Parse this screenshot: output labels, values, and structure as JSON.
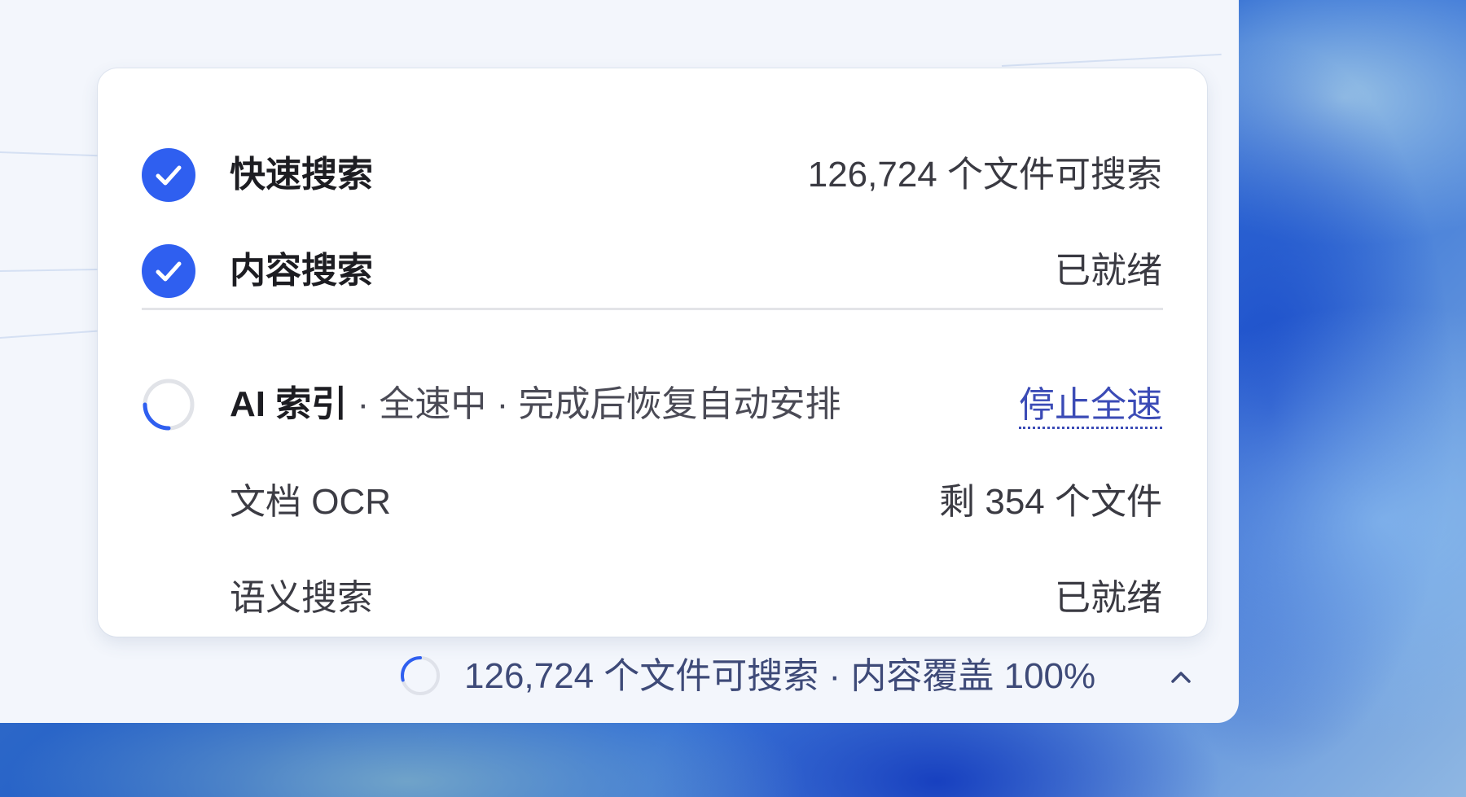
{
  "panel": {
    "rows": {
      "quick_search": {
        "label": "快速搜索",
        "status": "126,724 个文件可搜索",
        "icon": "check-circle-icon"
      },
      "content_search": {
        "label": "内容搜索",
        "status": "已就绪",
        "icon": "check-circle-icon"
      },
      "ai_index": {
        "label": "AI 索引",
        "separator": " · ",
        "detail": "全速中 · 完成后恢复自动安排",
        "action": "停止全速",
        "icon": "spinner-icon",
        "progress": 0.25
      },
      "doc_ocr": {
        "label": "文档 OCR",
        "status": "剩 354 个文件"
      },
      "semantic_search": {
        "label": "语义搜索",
        "status": "已就绪"
      }
    }
  },
  "status_bar": {
    "text": "126,724 个文件可搜索 · 内容覆盖 100%",
    "icon": "spinner-icon",
    "toggle_icon": "chevron-up-icon"
  },
  "colors": {
    "accent": "#2f5ff0",
    "link": "#3b4bb6",
    "status_text": "#3e4a78"
  }
}
